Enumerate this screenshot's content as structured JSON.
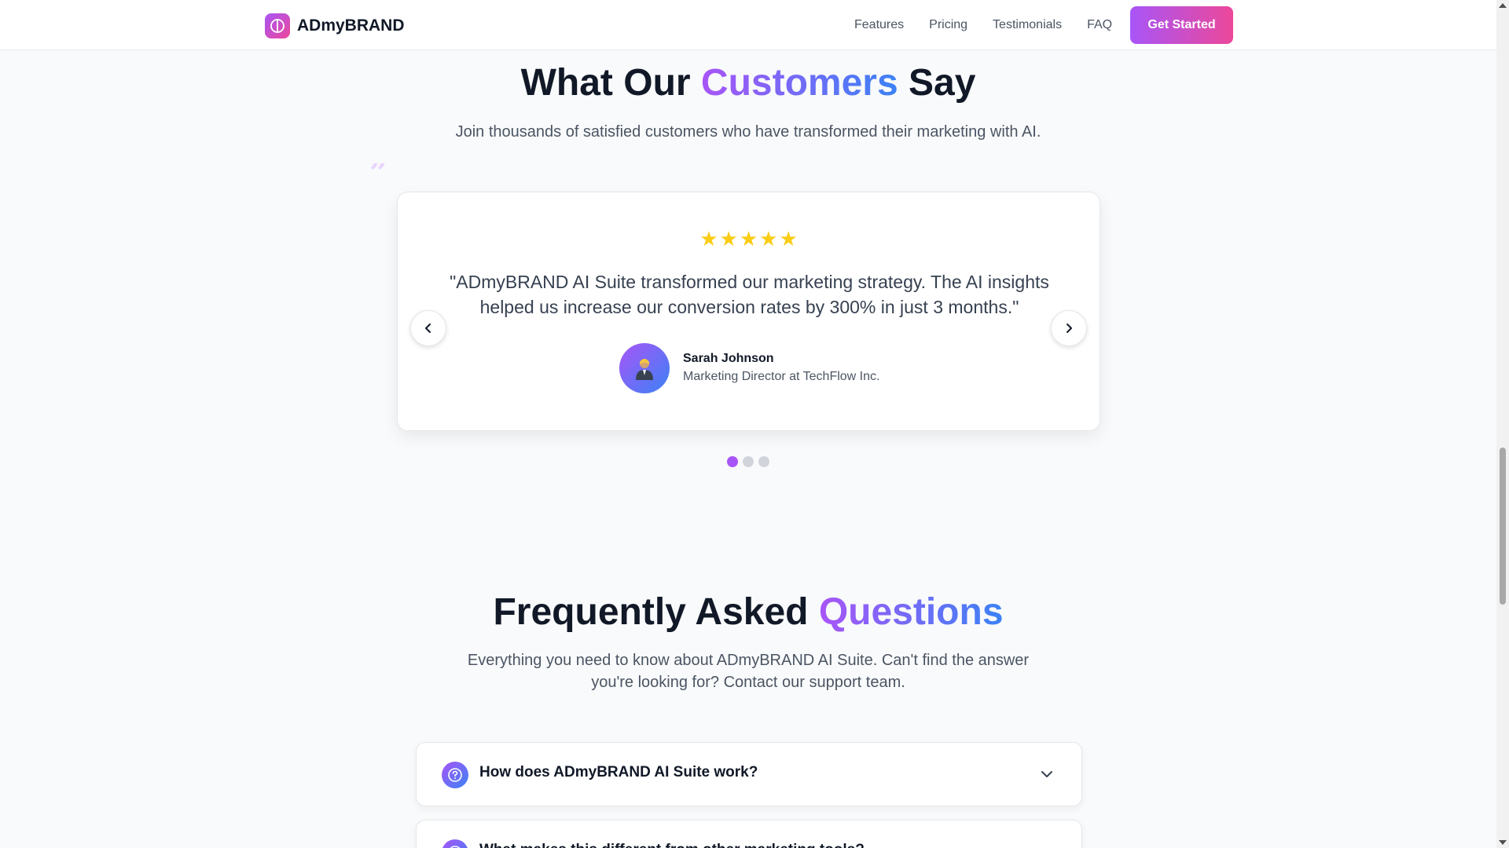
{
  "header": {
    "brand": "ADmyBRAND",
    "nav": [
      "Features",
      "Pricing",
      "Testimonials",
      "FAQ"
    ],
    "cta": "Get Started"
  },
  "testimonials": {
    "title_pre": "What Our ",
    "title_accent": "Customers",
    "title_post": " Say",
    "subtitle": "Join thousands of satisfied customers who have transformed their marketing with AI.",
    "rating": 5,
    "quote": "\"ADmyBRAND AI Suite transformed our marketing strategy. The AI insights helped us increase our conversion rates by 300% in just 3 months.\"",
    "author_name": "Sarah Johnson",
    "author_role": "Marketing Director at TechFlow Inc.",
    "slide_count": 3,
    "active_slide": 1
  },
  "faq": {
    "title_pre": "Frequently Asked ",
    "title_accent": "Questions",
    "subtitle": "Everything you need to know about ADmyBRAND AI Suite. Can't find the answer you're looking for? Contact our support team.",
    "items": [
      {
        "question": "How does ADmyBRAND AI Suite work?"
      },
      {
        "question": "What makes this different from other marketing tools?"
      }
    ]
  },
  "colors": {
    "accent_purple": "#a855f7",
    "accent_pink": "#ec4899",
    "accent_blue": "#3b82f6",
    "star": "#facc15"
  },
  "icons": {
    "brand": "brain-icon",
    "quote": "quote-icon",
    "prev": "chevron-left-icon",
    "next": "chevron-right-icon",
    "faq": "question-circle-icon",
    "expand": "chevron-down-icon"
  }
}
